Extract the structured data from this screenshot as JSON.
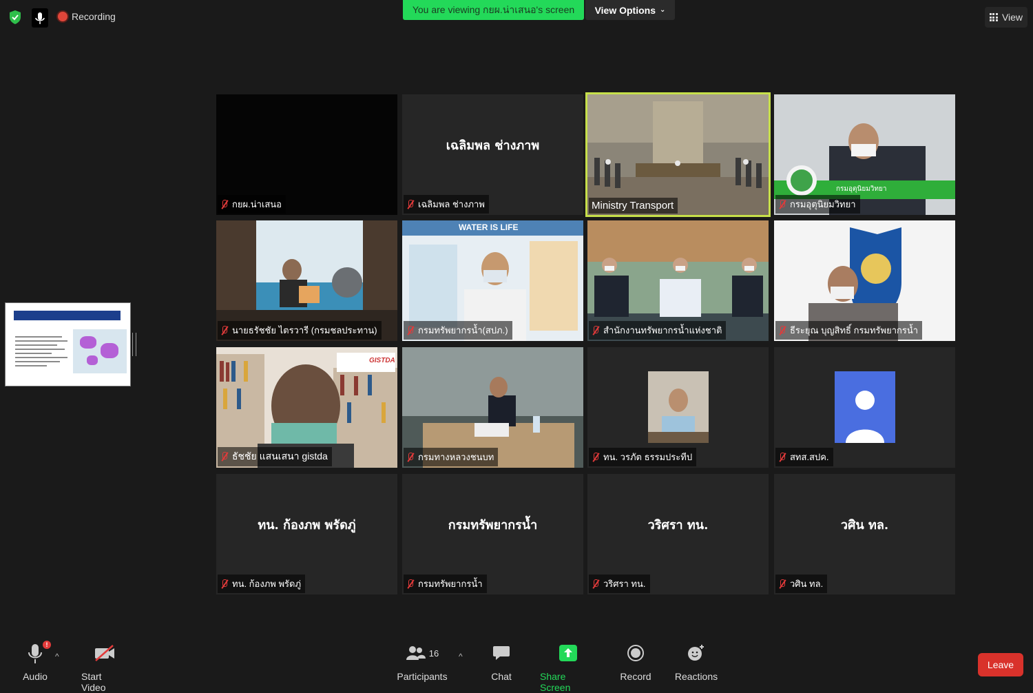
{
  "topbar": {
    "recording_label": "Recording",
    "viewing_banner": "You are viewing กยผ.น่าเสนอ's screen",
    "view_options_label": "View Options",
    "view_label": "View"
  },
  "tiles": [
    {
      "label": "กยผ.น่าเสนอ",
      "center_name": "",
      "muted": true
    },
    {
      "label": "เฉลิมพล ช่างภาพ",
      "center_name": "เฉลิมพล ช่างภาพ",
      "muted": true
    },
    {
      "label": "Ministry Transport",
      "center_name": "",
      "muted": false,
      "active": true
    },
    {
      "label": "กรมอุตุนิยมวิทยา",
      "center_name": "",
      "muted": true
    },
    {
      "label": "นายธรัชชัย ไตรวารี (กรมชลประทาน)",
      "center_name": "",
      "muted": true
    },
    {
      "label": "กรมทรัพยากรน้ำ(สปภ.)",
      "center_name": "",
      "muted": true
    },
    {
      "label": "สำนักงานทรัพยากรน้ำแห่งชาติ",
      "center_name": "",
      "muted": true
    },
    {
      "label": "ธีระยุณ บุญสิทธิ์ กรมทรัพยากรน้ำ",
      "center_name": "",
      "muted": true
    },
    {
      "label": "ธัชชัย แสนเสนา gistda",
      "center_name": "",
      "muted": true
    },
    {
      "label": "กรมทางหลวงชนบท",
      "center_name": "",
      "muted": true
    },
    {
      "label": "ทน. วรภัต ธรรมประทีป",
      "center_name": "",
      "muted": true
    },
    {
      "label": "สทส.สปค.",
      "center_name": "",
      "muted": true
    },
    {
      "label": "ทน. ก้องภพ พรัดภู่",
      "center_name": "ทน. ก้องภพ พรัดภู่",
      "muted": true
    },
    {
      "label": "กรมทรัพยากรน้ำ",
      "center_name": "กรมทรัพยากรน้ำ",
      "muted": true
    },
    {
      "label": "วริศรา ทน.",
      "center_name": "วริศรา ทน.",
      "muted": true
    },
    {
      "label": "วศิน ทล.",
      "center_name": "วศิน ทล.",
      "muted": true
    }
  ],
  "tile_texts": {
    "water_is_life": "WATER IS LIFE",
    "dept_banner": "กรมอุตุนิยมวิทยา",
    "gistda_logo": "GISTDA"
  },
  "toolbar": {
    "audio_label": "Audio",
    "start_video_label": "Start Video",
    "participants_label": "Participants",
    "participants_count": "16",
    "chat_label": "Chat",
    "share_screen_label": "Share Screen",
    "record_label": "Record",
    "reactions_label": "Reactions",
    "leave_label": "Leave",
    "audio_alert": "!"
  },
  "colors": {
    "background": "#1a1a1a",
    "tile_bg": "#262626",
    "share_green": "#23d959",
    "leave_red": "#d9322b",
    "active_speaker_border": "#c7e04a"
  }
}
